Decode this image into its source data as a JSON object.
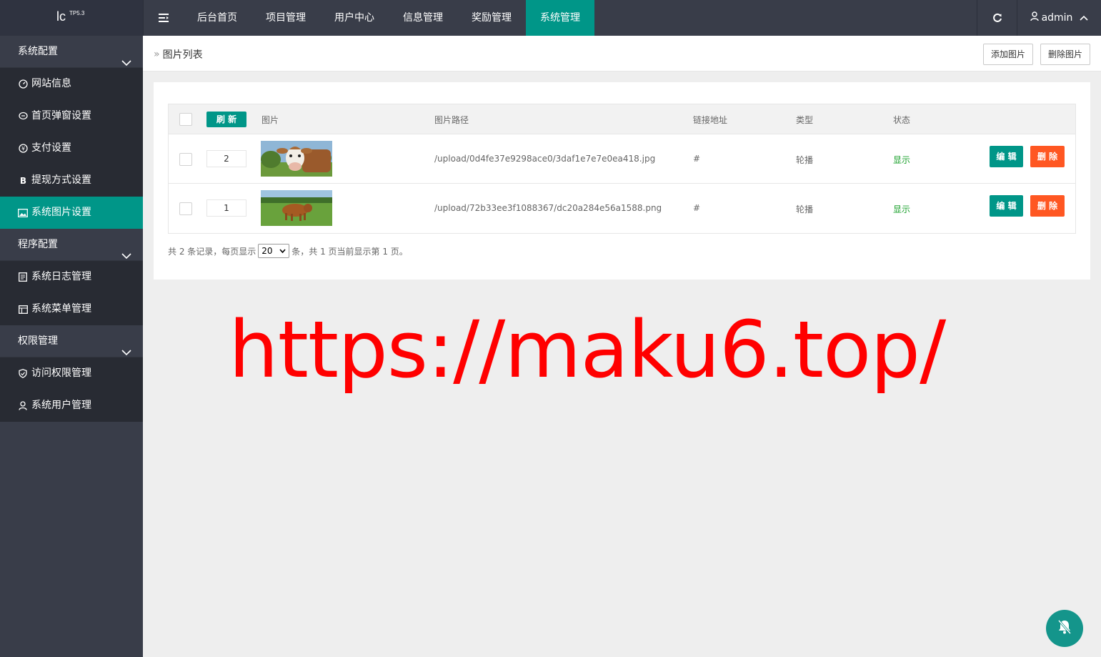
{
  "logo": {
    "main": "lc",
    "sup": "TP5.3"
  },
  "topnav": {
    "items": [
      "后台首页",
      "项目管理",
      "用户中心",
      "信息管理",
      "奖励管理",
      "系统管理"
    ],
    "active_index": 5,
    "user": "admin"
  },
  "sidebar": {
    "groups": [
      {
        "label": "系统配置",
        "items": [
          "网站信息",
          "首页弹窗设置",
          "支付设置",
          "提现方式设置",
          "系统图片设置"
        ]
      },
      {
        "label": "程序配置",
        "items": [
          "系统日志管理",
          "系统菜单管理"
        ]
      },
      {
        "label": "权限管理",
        "items": [
          "访问权限管理",
          "系统用户管理"
        ]
      }
    ],
    "active_item": "系统图片设置"
  },
  "breadcrumb": {
    "title": "图片列表"
  },
  "header_buttons": {
    "add": "添加图片",
    "delete": "删除图片"
  },
  "table": {
    "refresh_label": "刷 新",
    "columns": [
      "图片",
      "图片路径",
      "链接地址",
      "类型",
      "状态"
    ],
    "rows": [
      {
        "sort": "2",
        "path": "/upload/0d4fe37e9298ace0/3daf1e7e7e0ea418.jpg",
        "link": "#",
        "type": "轮播",
        "status": "显示",
        "edit": "编 辑",
        "del": "删 除"
      },
      {
        "sort": "1",
        "path": "/upload/72b33ee3f1088367/dc20a284e56a1588.png",
        "link": "#",
        "type": "轮播",
        "status": "显示",
        "edit": "编 辑",
        "del": "删 除"
      }
    ]
  },
  "pager": {
    "prefix": "共 2 条记录，每页显示",
    "per_page": "20",
    "suffix": "条，共 1 页当前显示第 1 页。"
  },
  "watermark": "https://maku6.top/",
  "colors": {
    "accent": "#009688",
    "danger": "#ff5722",
    "nav_bg": "#393d49",
    "status": "#1aa02b",
    "watermark": "#ff0000"
  }
}
